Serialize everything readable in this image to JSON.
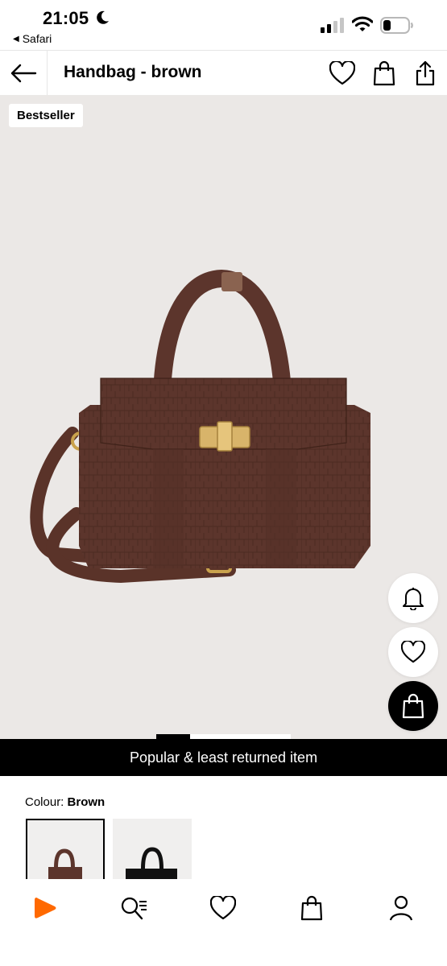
{
  "status_bar": {
    "time": "21:05",
    "back_app": "Safari"
  },
  "header": {
    "title": "Handbag - brown",
    "icons": [
      "back-arrow-icon",
      "heart-icon",
      "bag-icon",
      "share-icon"
    ]
  },
  "product": {
    "badge": "Bestseller",
    "promo": "Popular & least returned item",
    "colour_label": "Colour:",
    "colour_value": "Brown",
    "swatches": [
      "brown",
      "black"
    ],
    "fab_icons": [
      "bell-icon",
      "heart-icon",
      "bag-icon"
    ],
    "image_count": 2,
    "current_image": 1
  },
  "bottom_nav": {
    "items": [
      "home-play-icon",
      "search-icon",
      "wishlist-icon",
      "bag-icon",
      "profile-icon"
    ]
  },
  "colors": {
    "accent": "#ff6900",
    "bag_brown": "#5c352c",
    "image_bg": "#ebe8e6"
  }
}
